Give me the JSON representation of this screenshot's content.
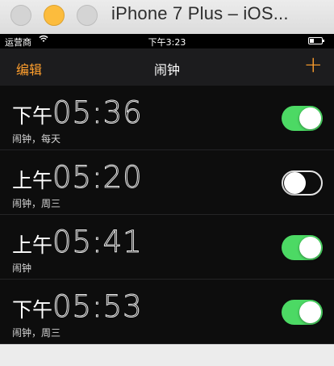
{
  "window": {
    "title": "iPhone 7 Plus – iOS..."
  },
  "status_bar": {
    "carrier": "运营商",
    "wifi_icon": "wifi-icon",
    "time": "下午3:23",
    "battery_icon": "battery-icon"
  },
  "nav": {
    "edit_label": "编辑",
    "title": "闹钟",
    "add_label": "+",
    "accent_color": "#ff9f2d"
  },
  "alarms": [
    {
      "ampm": "下午",
      "time": "05:36",
      "label": "闹钟，每天",
      "enabled": true
    },
    {
      "ampm": "上午",
      "time": "05:20",
      "label": "闹钟，周三",
      "enabled": false
    },
    {
      "ampm": "上午",
      "time": "05:41",
      "label": "闹钟",
      "enabled": true
    },
    {
      "ampm": "下午",
      "time": "05:53",
      "label": "闹钟，周三",
      "enabled": true
    }
  ],
  "colors": {
    "toggle_on": "#4cd964",
    "screen_background": "#0d0d0d"
  }
}
